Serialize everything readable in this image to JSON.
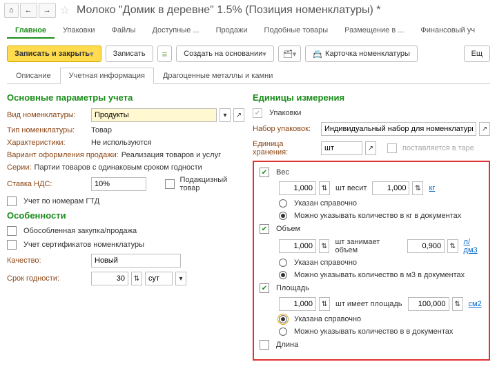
{
  "window": {
    "title": "Молоко \"Домик в деревне\" 1.5% (Позиция номенклатуры) *"
  },
  "menu": {
    "main": "Главное",
    "pack": "Упаковки",
    "files": "Файлы",
    "avail": "Доступные ...",
    "sales": "Продажи",
    "similar": "Подобные товары",
    "place": "Размещение в ...",
    "fin": "Финансовый уч"
  },
  "actions": {
    "save_close": "Записать и закрыть",
    "save": "Записать",
    "create_from": "Создать на основании",
    "card": "Карточка номенклатуры",
    "more": "Ещ"
  },
  "tabs": {
    "desc": "Описание",
    "acc": "Учетная информация",
    "metals": "Драгоценные металлы и камни"
  },
  "left": {
    "section": "Основные параметры учета",
    "kind_lbl": "Вид номенклатуры:",
    "kind_val": "Продукты",
    "type_lbl": "Тип номенклатуры:",
    "type_val": "Товар",
    "char_lbl": "Характеристики:",
    "char_val": "Не используются",
    "variant_lbl": "Вариант оформления продажи:",
    "variant_val": "Реализация товаров и услуг",
    "series_lbl": "Серии:",
    "series_val": "Партии товаров с одинаковым сроком годности",
    "vat_lbl": "Ставка НДС:",
    "vat_val": "10%",
    "excise": "Подакцизный товар",
    "gtd": "Учет по номерам ГТД",
    "section2": "Особенности",
    "isolated": "Обособленная закупка/продажа",
    "certs": "Учет сертификатов номенклатуры",
    "quality_lbl": "Качество:",
    "quality_val": "Новый",
    "shelf_lbl": "Срок годности:",
    "shelf_val": "30",
    "shelf_unit": "сут"
  },
  "right": {
    "section": "Единицы измерения",
    "packs": "Упаковки",
    "set_lbl": "Набор упаковок:",
    "set_val": "Индивидуальный набор для номенклатуры",
    "store_lbl": "Единица хранения:",
    "store_val": "шт",
    "tare": "поставляется в таре",
    "weight": "Вес",
    "num1": "1,000",
    "weighs": "шт весит",
    "w_val": "1,000",
    "kg": "кг",
    "ref_w": "Указан справочно",
    "can_kg": "Можно указывать количество в кг в документах",
    "volume": "Объем",
    "vol_txt": "шт занимает объем",
    "vol_val": "0,900",
    "ldm3": "л/дм3",
    "ref_v": "Указан справочно",
    "can_m3": "Можно указывать количество в м3 в документах",
    "area": "Площадь",
    "area_txt": "шт имеет площадь",
    "area_val": "100,000",
    "cm2": "см2",
    "ref_a": "Указана справочно",
    "can_a": "Можно указывать количество в  в документах",
    "length": "Длина"
  }
}
